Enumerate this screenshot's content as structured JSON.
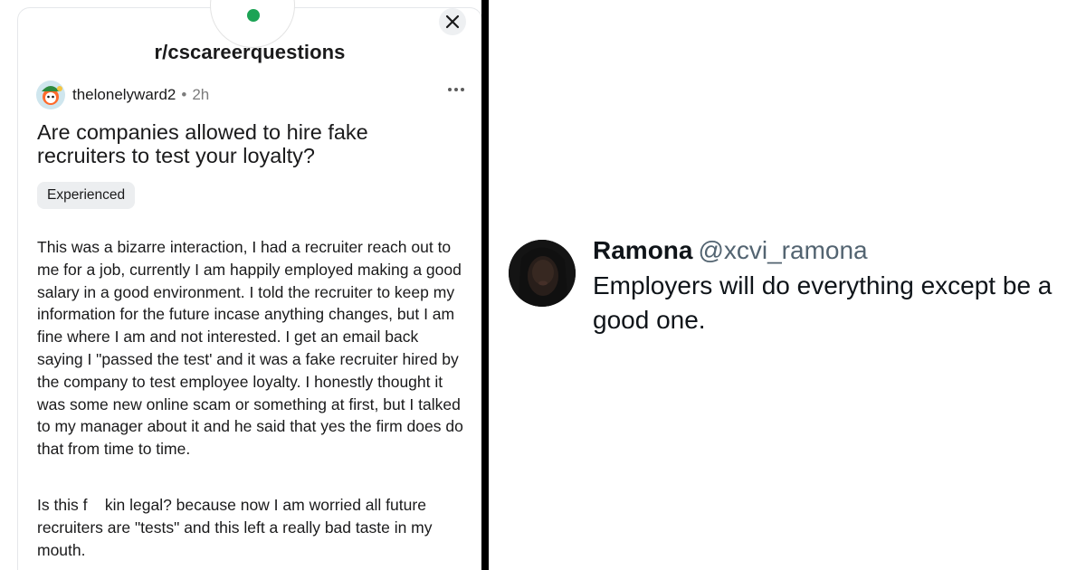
{
  "reddit_post": {
    "subreddit": "r/cscareerquestions",
    "username": "thelonelyward2",
    "separator": "•",
    "time": "2h",
    "title": "Are companies allowed to hire fake recruiters to test your loyalty?",
    "flair": "Experienced",
    "body_paragraph_1": "This was a bizarre interaction, I had a recruiter reach out to me for a job, currently I am happily employed making a good salary in a good environment. I told the recruiter to keep my information for the future incase anything changes, but I am fine where I am and not interested. I get an email back saying I \"passed the test' and it was a fake recruiter hired by the company to test employee loyalty. I honestly thought it was some new online scam or something at first, but I talked to my manager about it and he said that yes the firm does do that from time to time.",
    "body_paragraph_2": "Is this f    kin legal? because now I am worried all future recruiters are \"tests\" and this left a really bad taste in my mouth.",
    "icons": {
      "close": "close-icon",
      "more": "more-options-icon",
      "subreddit_avatar": "subreddit-avatar",
      "user_avatar": "user-avatar"
    },
    "colors": {
      "online_dot": "#1ca355",
      "flair_bg": "#eceef0",
      "meta_gray": "#7c7c7c"
    }
  },
  "tweet": {
    "display_name": "Ramona",
    "handle": "@xcvi_ramona",
    "text": "Employers will do everything except be a good one.",
    "colors": {
      "handle_gray": "#536471",
      "text": "#0f1419"
    }
  }
}
